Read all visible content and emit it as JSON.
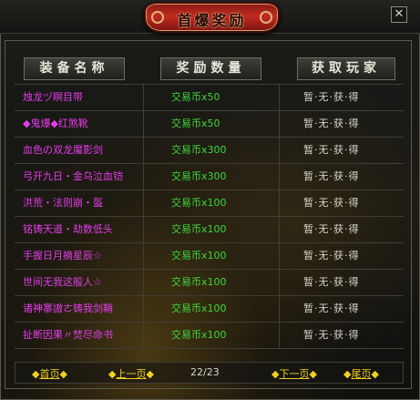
{
  "window": {
    "title": "首爆奖励",
    "close_label": "✕"
  },
  "table": {
    "headers": [
      "装备名称",
      "奖励数量",
      "获取玩家"
    ],
    "rows": [
      {
        "item": "烛龙ヅ瞑目带",
        "reward": "交易币x50",
        "player": "暂·无·获·得"
      },
      {
        "item": "◆鬼爆◆红煞靴",
        "reward": "交易币x50",
        "player": "暂·无·获·得"
      },
      {
        "item": "血色の双龙魔影剑",
        "reward": "交易币x300",
        "player": "暂·无·获·得"
      },
      {
        "item": "弓开九日・金乌泣血铠",
        "reward": "交易币x300",
        "player": "暂·无·获·得"
      },
      {
        "item": "洪荒・法则崩・盔",
        "reward": "交易币x100",
        "player": "暂·无·获·得"
      },
      {
        "item": "铭铸天道・劫数低头",
        "reward": "交易币x100",
        "player": "暂·无·获·得"
      },
      {
        "item": "手握日月摘星辰☆",
        "reward": "交易币x100",
        "player": "暂·无·获·得"
      },
      {
        "item": "世间无我这般人☆",
        "reward": "交易币x100",
        "player": "暂·无·获·得"
      },
      {
        "item": "诸神寨謸ㄜ铸我剑鞘",
        "reward": "交易币x100",
        "player": "暂·无·获·得"
      },
      {
        "item": "扯断因果〃焚尽命书",
        "reward": "交易币x100",
        "player": "暂·无·获·得"
      }
    ]
  },
  "pager": {
    "first": "首页",
    "prev": "上一页",
    "page": "22/23",
    "next": "下一页",
    "last": "尾页"
  },
  "colors": {
    "item_name": "#e23ee8",
    "reward": "#3fd63a",
    "player": "#d8d6cc",
    "pager_link": "#f0d020"
  }
}
